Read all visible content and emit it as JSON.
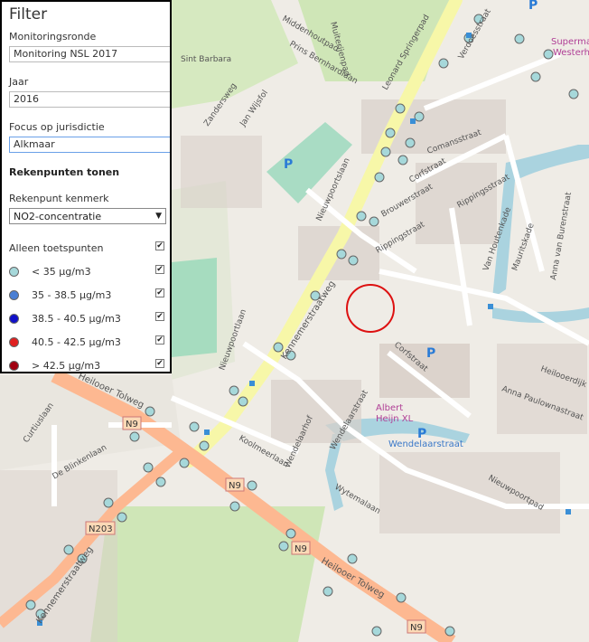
{
  "filter_panel": {
    "title": "Filter",
    "monitoring_label": "Monitoringsronde",
    "monitoring_value": "Monitoring NSL 2017",
    "year_label": "Jaar",
    "year_value": "2016",
    "jurisdiction_label": "Focus op jurisdictie",
    "jurisdiction_value": "Alkmaar",
    "section_title": "Rekenpunten tonen",
    "kenmerk_label": "Rekenpunt kenmerk",
    "kenmerk_value": "NO2-concentratie",
    "toetspunten_label": "Alleen toetspunten",
    "legend": [
      {
        "label": "< 35 µg/m3",
        "color": "#a6d8da",
        "checked": true
      },
      {
        "label": "35 - 38.5 µg/m3",
        "color": "#4a7fd4",
        "checked": true
      },
      {
        "label": "38.5 - 40.5 µg/m3",
        "color": "#1010c8",
        "checked": true
      },
      {
        "label": "40.5 - 42.5 µg/m3",
        "color": "#e02020",
        "checked": true
      },
      {
        "label": "> 42.5 µg/m3",
        "color": "#a00010",
        "checked": true
      }
    ],
    "check_mark": "✔",
    "dropdown_arrow": "▼"
  },
  "map": {
    "street_labels": [
      "Sint Barbara",
      "Zandersweg",
      "Jan Wijsfol",
      "Middenhoutpad",
      "Prins Bernhardlaan",
      "Muiterijenpad",
      "Leonard Springerpad",
      "Verdoesstraat",
      "Comansstraat",
      "Corfstraat",
      "Brouwerstraat",
      "Rippingsstraat",
      "Ripping­straat",
      "Nieuwpoortslaan",
      "Kennemerstraatweg",
      "Nieuwpoortlaan",
      "Van Houtenkade",
      "Mauritskade",
      "Anna van Burenstraat",
      "Heiloo­erdijk",
      "Anna Paulownastraat",
      "Corfstraat",
      "Wendelaarstraat",
      "Koolmeerlaan",
      "Wendelaarhof",
      "Wytemalaan",
      "Nieuwpoortpad",
      "Heilooer Tolweg",
      "Curtiuslaan",
      "De Blinkenlaan",
      "Kennemerstraatweg",
      "N203",
      "N9",
      "N9",
      "N9",
      "N9",
      "Albert Heijn XL",
      "Wendelaarstraat",
      "Supermarkt Westerhout"
    ],
    "parking_label": "P",
    "shop_name_1": "Albert",
    "shop_name_2": "Heijn XL",
    "supermarket_1": "Superma",
    "supermarket_2": "Westerh",
    "wendelaar_parking": "Wendelaarstraat",
    "road_n9": "N9",
    "road_n203": "N203"
  },
  "colors": {
    "points": "#a6d8da",
    "highlight": "#dd1111",
    "main_road": "#f7f7a8",
    "highway": "#fdb891",
    "water": "#aad3df",
    "green": "#cdebb0"
  }
}
